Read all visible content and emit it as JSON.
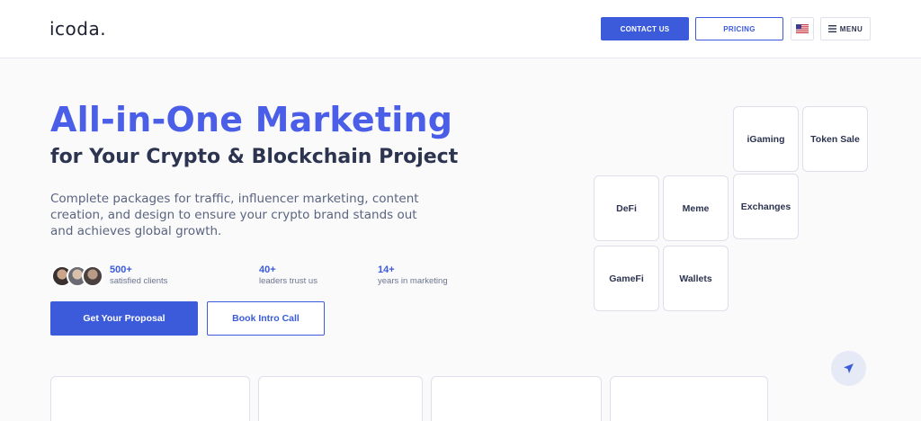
{
  "header": {
    "logo_text": "icoda",
    "logo_dot": ".",
    "contact_label": "CONTACT US",
    "pricing_label": "PRICING",
    "flag_icon": "us-flag-icon",
    "menu_label": "MENU",
    "menu_icon": "hamburger-icon"
  },
  "hero": {
    "title": "All-in-One Marketing",
    "subtitle": "for Your Crypto & Blockchain Project",
    "description": "Complete packages for traffic, influencer marketing, content creation, and design to ensure your crypto brand stands out and achieves global growth."
  },
  "stats": [
    {
      "value": "500+",
      "label": "satisfied clients"
    },
    {
      "value": "40+",
      "label": "leaders trust us"
    },
    {
      "value": "14+",
      "label": "years in marketing"
    }
  ],
  "cta": {
    "primary": "Get Your Proposal",
    "secondary": "Book Intro Call"
  },
  "categories": [
    "iGaming",
    "Token Sale",
    "DeFi",
    "Meme",
    "Exchanges",
    "GameFi",
    "Wallets"
  ],
  "colors": {
    "accent": "#3b5bdb",
    "title": "#4a5ee8",
    "text": "#2c3450"
  },
  "send_icon": "paper-plane-icon"
}
